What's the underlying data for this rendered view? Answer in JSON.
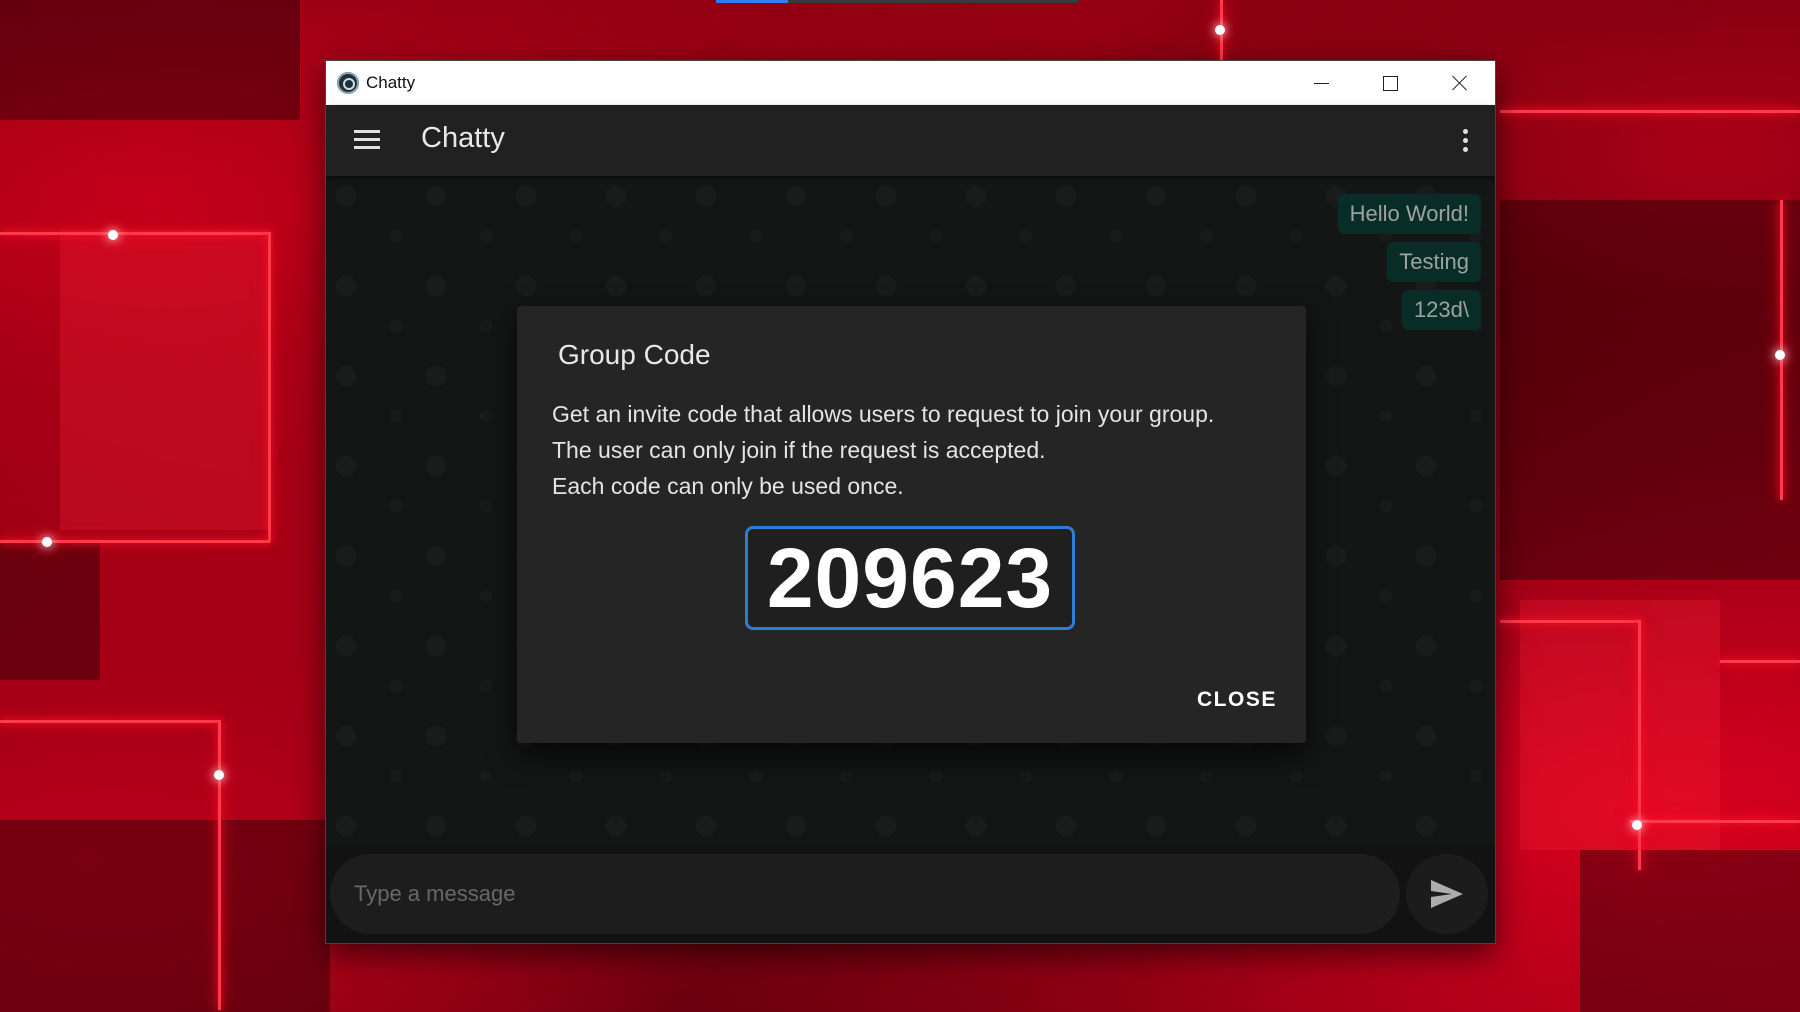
{
  "window": {
    "title": "Chatty"
  },
  "appbar": {
    "title": "Chatty"
  },
  "messages": [
    "Hello World!",
    "Testing",
    "123d\\"
  ],
  "composer": {
    "placeholder": "Type a message"
  },
  "dialog": {
    "title": "Group Code",
    "lines": [
      "Get an invite code that allows users to request to join your group.",
      "The user can only join if the request is accepted.",
      "Each code can only be used once."
    ],
    "code": "209623",
    "close_label": "CLOSE"
  },
  "colors": {
    "accent": "#2f7cd6",
    "bubble": "#0b3b33",
    "dialog_bg": "#252525",
    "appbar_bg": "#212121"
  },
  "icons": {
    "app": "chatty-logo-icon",
    "menu": "hamburger-menu-icon",
    "more": "more-vertical-icon",
    "send": "send-icon"
  }
}
